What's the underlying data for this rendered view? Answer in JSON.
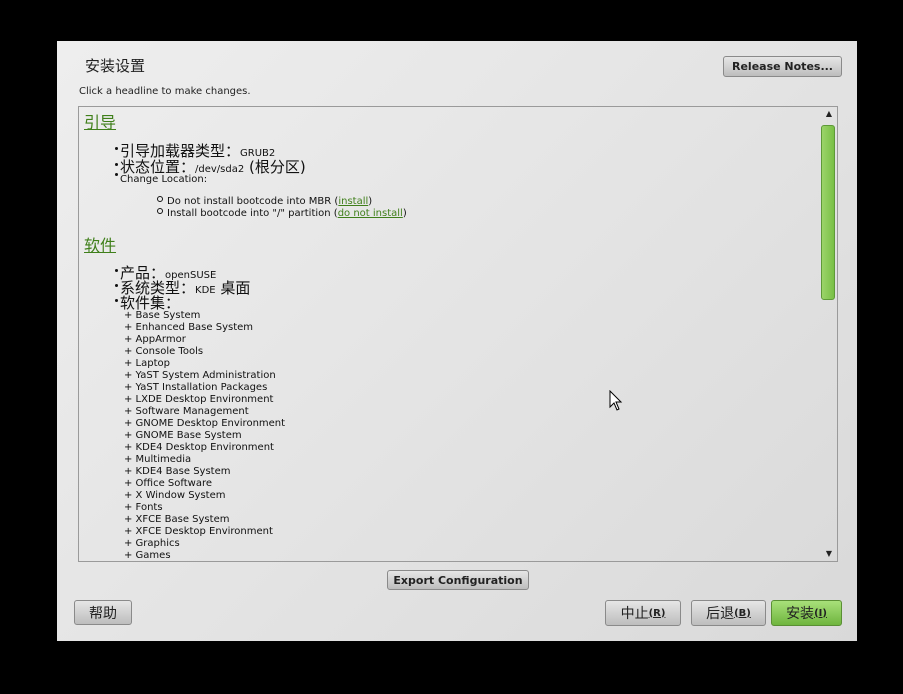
{
  "window": {
    "title": "安装设置",
    "hint": "Click a headline to make changes.",
    "release_notes_label": "Release Notes..."
  },
  "booting": {
    "heading": "引导",
    "loader_type_label": "引导加载器类型：",
    "loader_type_value": "GRUB2",
    "location_label": "状态位置：",
    "location_value": "/dev/sda2",
    "location_suffix": " (根分区)",
    "change_location": "Change Location:",
    "opt1_text": "Do not install bootcode into MBR (",
    "opt1_link": "install",
    "opt2_text": "Install bootcode into \"/\" partition (",
    "opt2_link": "do not install",
    "close_paren": ")"
  },
  "software": {
    "heading": "软件",
    "product_label": "产品：",
    "product_value": "openSUSE",
    "system_type_label": "系统类型：",
    "system_type_value": "KDE",
    "system_type_suffix": " 桌面",
    "patterns_label": "软件集：",
    "patterns": [
      "+ Base System",
      "+ Enhanced Base System",
      "+ AppArmor",
      "+ Console Tools",
      "+ Laptop",
      "+ YaST System Administration",
      "+ YaST Installation Packages",
      "+ LXDE Desktop Environment",
      "+ Software Management",
      "+ GNOME Desktop Environment",
      "+ GNOME Base System",
      "+ KDE4 Desktop Environment",
      "+ Multimedia",
      "+ KDE4 Base System",
      "+ Office Software",
      "+ X Window System",
      "+ Fonts",
      "+ XFCE Base System",
      "+ XFCE Desktop Environment",
      "+ Graphics",
      "+ Games"
    ]
  },
  "buttons": {
    "export": "Export Configuration",
    "help": "帮助",
    "abort": "中止",
    "abort_key": "(R)",
    "back": "后退",
    "back_key": "(B)",
    "install": "安装",
    "install_key": "(I)"
  },
  "scrollbar": {
    "up": "▲",
    "down": "▼"
  },
  "colors": {
    "accent": "#3f7f1a",
    "primary_button": "#7fc14a",
    "background": "#000000"
  }
}
